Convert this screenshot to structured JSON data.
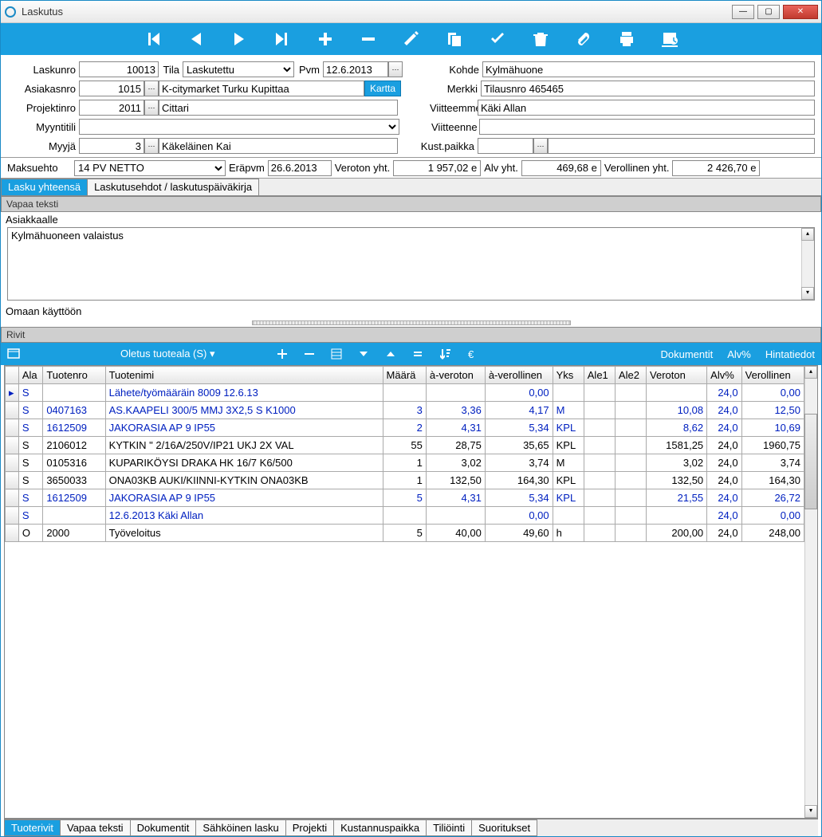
{
  "window": {
    "title": "Laskutus"
  },
  "form": {
    "labels": {
      "laskunro": "Laskunro",
      "tila": "Tila",
      "pvm": "Pvm",
      "asiakasnro": "Asiakasnro",
      "projektinro": "Projektinro",
      "myyntitili": "Myyntitili",
      "myyja": "Myyjä",
      "kohde": "Kohde",
      "merkki": "Merkki",
      "viitteemme": "Viitteemme",
      "viitteenne": "Viitteenne",
      "kustpaikka": "Kust.paikka",
      "kartta": "Kartta"
    },
    "values": {
      "laskunro": "10013",
      "tila": "Laskutettu",
      "pvm": "12.6.2013",
      "asiakasnro": "1015",
      "asiakas_name": "K-citymarket Turku Kupittaa",
      "projektinro": "2011",
      "projekti_name": "Cittari",
      "myyntitili": "",
      "myyja": "3",
      "myyja_name": "Käkeläinen Kai",
      "kohde": "Kylmähuone",
      "merkki": "Tilausnro 465465",
      "viitteemme": "Käki Allan",
      "viitteenne": "",
      "kustpaikka": "",
      "kustpaikka_name": ""
    }
  },
  "totals": {
    "maksuehto_lbl": "Maksuehto",
    "maksuehto": "14 PV NETTO",
    "erapvm_lbl": "Eräpvm",
    "erapvm": "26.6.2013",
    "veroton_lbl": "Veroton yht.",
    "veroton": "1 957,02 e",
    "alv_lbl": "Alv yht.",
    "alv": "469,68 e",
    "verollinen_lbl": "Verollinen yht.",
    "verollinen": "2 426,70 e"
  },
  "top_tabs": [
    "Lasku yhteensä",
    "Laskutusehdot / laskutuspäiväkirja"
  ],
  "free_text": {
    "vapaa_teksti": "Vapaa teksti",
    "asiakkaalle": "Asiakkaalle",
    "asiakkaalle_val": "Kylmähuoneen valaistus",
    "omaan": "Omaan käyttöön"
  },
  "rows_section": {
    "title": "Rivit",
    "oletus": "Oletus tuoteala (S)",
    "links": {
      "dokumentit": "Dokumentit",
      "alv": "Alv%",
      "hintatiedot": "Hintatiedot"
    }
  },
  "grid": {
    "headers": [
      "Ala",
      "Tuotenro",
      "Tuotenimi",
      "Määrä",
      "à-veroton",
      "à-verollinen",
      "Yks",
      "Ale1",
      "Ale2",
      "Veroton",
      "Alv%",
      "Verollinen"
    ],
    "rows": [
      {
        "blue": true,
        "cells": [
          "S",
          "",
          "Lähete/työmääräin 8009 12.6.13",
          "",
          "",
          "0,00",
          "",
          "",
          "",
          "",
          "24,0",
          "0,00"
        ]
      },
      {
        "blue": true,
        "cells": [
          "S",
          "0407163",
          "AS.KAAPELI 300/5 MMJ 3X2,5 S  K1000",
          "3",
          "3,36",
          "4,17",
          "M",
          "",
          "",
          "10,08",
          "24,0",
          "12,50"
        ]
      },
      {
        "blue": true,
        "cells": [
          "S",
          "1612509",
          "JAKORASIA AP 9 IP55",
          "2",
          "4,31",
          "5,34",
          "KPL",
          "",
          "",
          "8,62",
          "24,0",
          "10,69"
        ]
      },
      {
        "blue": false,
        "cells": [
          "S",
          "2106012",
          "KYTKIN \" 2/16A/250V/IP21 UKJ 2X VAL",
          "55",
          "28,75",
          "35,65",
          "KPL",
          "",
          "",
          "1581,25",
          "24,0",
          "1960,75"
        ]
      },
      {
        "blue": false,
        "cells": [
          "S",
          "0105316",
          "KUPARIKÖYSI DRAKA HK 16/7 K6/500",
          "1",
          "3,02",
          "3,74",
          "M",
          "",
          "",
          "3,02",
          "24,0",
          "3,74"
        ]
      },
      {
        "blue": false,
        "cells": [
          "S",
          "3650033",
          "ONA03KB AUKI/KIINNI-KYTKIN ONA03KB",
          "1",
          "132,50",
          "164,30",
          "KPL",
          "",
          "",
          "132,50",
          "24,0",
          "164,30"
        ]
      },
      {
        "blue": true,
        "cells": [
          "S",
          "1612509",
          "JAKORASIA AP 9 IP55",
          "5",
          "4,31",
          "5,34",
          "KPL",
          "",
          "",
          "21,55",
          "24,0",
          "26,72"
        ]
      },
      {
        "blue": true,
        "cells": [
          "S",
          "",
          "12.6.2013 Käki Allan",
          "",
          "",
          "0,00",
          "",
          "",
          "",
          "",
          "24,0",
          "0,00"
        ]
      },
      {
        "blue": false,
        "cells": [
          "O",
          "2000",
          "Työveloitus",
          "5",
          "40,00",
          "49,60",
          "h",
          "",
          "",
          "200,00",
          "24,0",
          "248,00"
        ]
      }
    ]
  },
  "bottom_tabs": [
    "Tuoterivit",
    "Vapaa teksti",
    "Dokumentit",
    "Sähköinen lasku",
    "Projekti",
    "Kustannuspaikka",
    "Tiliöinti",
    "Suoritukset"
  ]
}
